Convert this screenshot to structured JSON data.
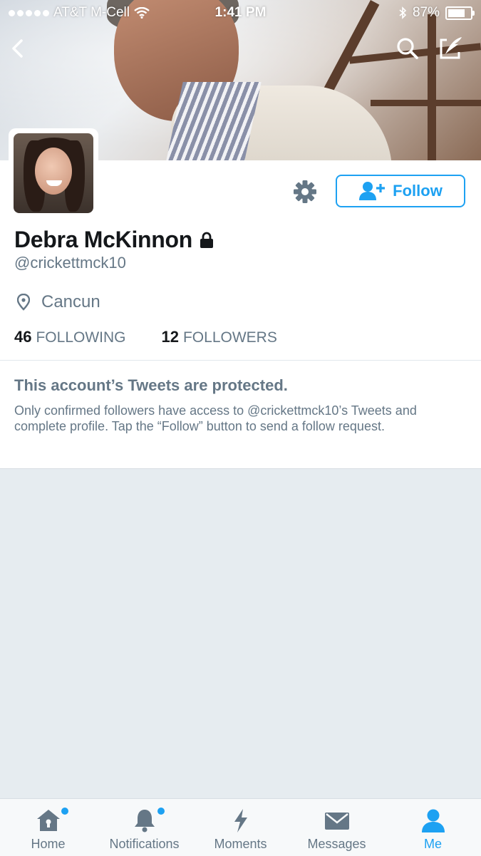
{
  "status_bar": {
    "carrier": "AT&T M-Cell",
    "time": "1:41 PM",
    "battery": "87%",
    "battery_level": 0.87
  },
  "header": {
    "icons": [
      "back-icon",
      "search-icon",
      "compose-icon"
    ]
  },
  "profile": {
    "name": "Debra McKinnon",
    "handle": "@crickettmck10",
    "location": "Cancun",
    "follow_label": "Follow",
    "following_count": "46",
    "following_label": "FOLLOWING",
    "followers_count": "12",
    "followers_label": "FOLLOWERS"
  },
  "protected": {
    "title": "This account’s Tweets are protected.",
    "body": "Only confirmed followers have access to @crickettmck10’s Tweets and complete profile. Tap the “Follow” button to send a follow request."
  },
  "tabs": [
    {
      "label": "Home",
      "icon": "home-icon",
      "has_dot": true
    },
    {
      "label": "Notifications",
      "icon": "bell-icon",
      "has_dot": true
    },
    {
      "label": "Moments",
      "icon": "lightning-icon",
      "has_dot": false
    },
    {
      "label": "Messages",
      "icon": "envelope-icon",
      "has_dot": false
    },
    {
      "label": "Me",
      "icon": "person-icon",
      "has_dot": false,
      "active": true
    }
  ],
  "colors": {
    "accent": "#1da1f2",
    "secondary_text": "#657786",
    "background": "#e6ecf0"
  }
}
